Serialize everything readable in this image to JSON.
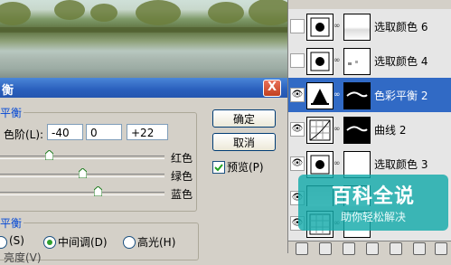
{
  "dialog": {
    "title": "衡",
    "group_color_balance": "平衡",
    "levels_label": "色阶(L):",
    "levels": [
      "-40",
      "0",
      "+22"
    ],
    "ok_label": "确定",
    "cancel_label": "取消",
    "preview_label": "预览(P)",
    "preview_checked": true,
    "close_glyph": "X",
    "sliders": [
      {
        "right_label": "红色",
        "value": -40
      },
      {
        "right_label": "绿色",
        "value": 0
      },
      {
        "right_label": "蓝色",
        "value": 22
      }
    ],
    "group_tone_balance": "平衡",
    "tone_options": [
      {
        "label": "(S)",
        "selected": false
      },
      {
        "label": "中间调(D)",
        "selected": true
      },
      {
        "label": "高光(H)",
        "selected": false
      }
    ],
    "partial_bottom_label": "亮度(V)"
  },
  "layers": [
    {
      "name": "选取颜色 6",
      "visible": false,
      "selected": false,
      "mask": "white-gradient"
    },
    {
      "name": "选取颜色 4",
      "visible": false,
      "selected": false,
      "mask": "white-dots"
    },
    {
      "name": "色彩平衡 2",
      "visible": true,
      "selected": true,
      "mask": "black-shape"
    },
    {
      "name": "曲线 2",
      "visible": true,
      "selected": false,
      "mask": "black-shape"
    },
    {
      "name": "选取颜色 3",
      "visible": true,
      "selected": false,
      "mask": "white"
    },
    {
      "name": "",
      "visible": true,
      "selected": false,
      "mask": "white"
    },
    {
      "name": "",
      "visible": true,
      "selected": false,
      "mask": "white"
    }
  ],
  "watermark": {
    "title": "百科全说",
    "subtitle": "助你轻松解决"
  },
  "colors": {
    "titlebar": "#2a5fbc",
    "selected_layer": "#316ac5",
    "watermark": "#14aaaa"
  }
}
